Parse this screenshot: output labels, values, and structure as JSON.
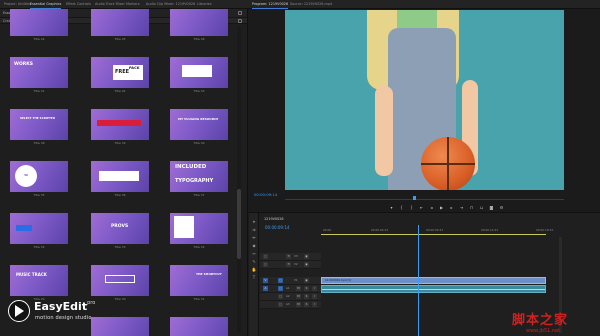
{
  "top_tabs": [
    {
      "label": "Project: Untitled",
      "active": false
    },
    {
      "label": "Essential Graphics",
      "active": true
    },
    {
      "label": "Effect Controls",
      "active": false
    },
    {
      "label": "Audio Track Mixer",
      "active": false
    },
    {
      "label": "Markers",
      "active": false
    },
    {
      "label": "Audio Clip Mixer: 1219V0026",
      "active": false
    },
    {
      "label": "Libraries",
      "active": false
    },
    {
      "label": "Program: 1219V0026",
      "active": true
    },
    {
      "label": "Source: 1219V0026.mp4",
      "active": false
    }
  ],
  "left_panel": {
    "panel_title": "Essential Graphics",
    "browse_tabs": [
      "Browse",
      "Edit"
    ],
    "category": "Creative Typography",
    "captions": [
      "Title 44",
      "Title 45",
      "Title 46",
      "Title 41",
      "Title 42",
      "Title 43",
      "Title 38",
      "Title 39",
      "Title 40",
      "Title 35",
      "Title 36",
      "Title 37",
      "Title 32",
      "Title 33",
      "Title 34",
      "Title 29",
      "Title 30",
      "Title 31"
    ],
    "thumb_texts": {
      "t_works": "WORKS",
      "t_free": "FREE",
      "t_pack": "PACK",
      "t_select": "SELECT THE SCRIPTER",
      "t_my_pluging": "MY PLUGING RESOURCE",
      "t_50": "50",
      "t_included": "INCLUDED",
      "t_typography": "TYPOGRAPHY",
      "t_provs": "PROVS",
      "t_music": "MUSIC TRACK",
      "t_the_shortcut": "THE SHORTCUT"
    }
  },
  "logo": {
    "name": "EasyEdit",
    "pro": "pro",
    "tagline": "motion design studio"
  },
  "program_monitor": {
    "timecode": "00:00:09:14"
  },
  "timeline": {
    "tab_label": "1219V0026",
    "timecode": "00:00:09:14",
    "ruler": [
      "00:00",
      "00:00:04:23",
      "00:00:09:23",
      "00:00:14:23",
      "00:00:19:23"
    ],
    "tracks": [
      {
        "name": "V3",
        "kind": "video"
      },
      {
        "name": "V2",
        "kind": "video"
      },
      {
        "name": "V1",
        "kind": "video"
      },
      {
        "name": "A1",
        "kind": "audio"
      },
      {
        "name": "A2",
        "kind": "audio"
      },
      {
        "name": "A3",
        "kind": "audio"
      }
    ],
    "video_clip_label": "1219V0026.mp4 [V]"
  },
  "watermark": {
    "text": "脚本之家",
    "url": "www.jb51.net"
  },
  "colors": {
    "accent_blue": "#3e9bf2",
    "thumb_purple": "#7f5bc8",
    "video_clip": "#6d8fc7",
    "audio_clip": "#3b8a9b",
    "watermark_red": "#d22020"
  }
}
